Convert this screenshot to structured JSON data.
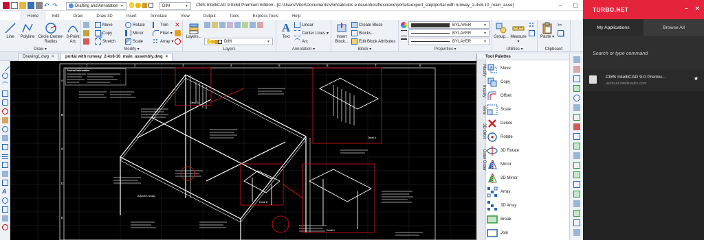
{
  "window": {
    "title": "CMS IntelliCAD 9.0x64 Premium Edition  -  [C:\\Users\\Vitor\\Documents\\vhri\\calculos e desenhos\\flexcrane\\portals\\export_step\\portal with runway_2-4x8-10_main_asse]",
    "workspace": "Drafting and Annotation",
    "layer_combo": "DIM"
  },
  "tabs": [
    "Home",
    "Edit",
    "Draw",
    "Draw 3D",
    "Insert",
    "Annotate",
    "View",
    "Output",
    "Tools",
    "Express Tools",
    "Help"
  ],
  "ribbon": {
    "draw": {
      "label": "Draw",
      "line": "Line",
      "polyline": "Polyline",
      "circle": "Circle Center-Radius",
      "arc": "3-Point Arc"
    },
    "modify": {
      "label": "Modify",
      "move": "Move",
      "rotate": "Rotate",
      "trim": "Trim",
      "copy": "Copy",
      "mirror": "Mirror",
      "fillet": "Fillet",
      "stretch": "Stretch",
      "scale": "Scale",
      "array": "Array"
    },
    "layers": {
      "label": "Layers",
      "button": "Layers...",
      "current": "DIM"
    },
    "annotation": {
      "label": "Annotation",
      "text": "Text",
      "linear": "Linear",
      "center_lines": "Center Lines",
      "arc": "Arc"
    },
    "block": {
      "label": "Block",
      "insert_block": "Insert Block...",
      "create_block": "Create Block",
      "blocks": "Blocks...",
      "edit_attributes": "Edit Block Attributes"
    },
    "properties": {
      "label": "Properties",
      "color": "BYLAYER",
      "linetype": "BYLAYER",
      "lineweight": "BYLAYER"
    },
    "utilities": {
      "label": "Utilities",
      "group": "Group...",
      "measure": "Measure"
    },
    "clipboard": {
      "label": "Clipboard",
      "paste": "Paste"
    }
  },
  "documents": [
    {
      "name": "Drawing1.dwg",
      "active": false
    },
    {
      "name": "portal with runway_2-4x8-10_main_assembly.dwg",
      "active": true
    }
  ],
  "drawing": {
    "columns": [
      "1",
      "2",
      "3",
      "4",
      "5",
      "6",
      "7",
      "8"
    ],
    "rows": [
      "A",
      "B",
      "C",
      "D",
      "E"
    ],
    "table_title": "General Information",
    "detail_labels": [
      "Detail A",
      "Detail B",
      "Detail C",
      "Detail D"
    ],
    "note": "Adjusted runway"
  },
  "tool_palettes": {
    "title": "Tool Palettes",
    "side_tabs": [
      "Modify",
      "Inquiry",
      "View",
      "3D Orbit",
      "Draw Order"
    ],
    "tools": [
      "Move",
      "Copy",
      "Offset",
      "Scale",
      "Delete",
      "Rotate",
      "3D Rotate",
      "Mirror",
      "3D Mirror",
      "Array",
      "3D Array",
      "Break",
      "Join"
    ]
  },
  "turbo": {
    "title": "TURBO.NET",
    "tab_apps": "My Applications",
    "tab_browse": "Browse All",
    "search_placeholder": "Search or type command",
    "app_name": "CMS IntelliCAD 9.0 Premiu...",
    "app_url": "uscloud.intellicadcs.com"
  }
}
